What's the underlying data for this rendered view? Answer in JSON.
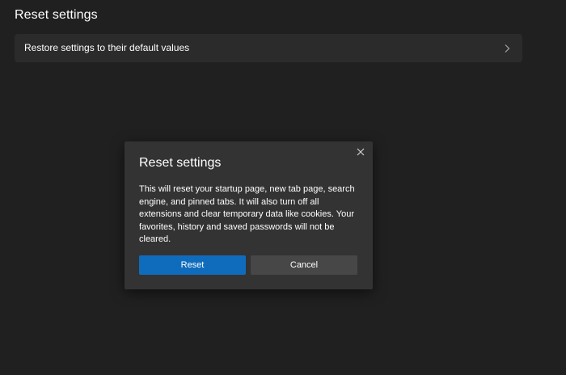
{
  "page": {
    "title": "Reset settings"
  },
  "settings_row": {
    "label": "Restore settings to their default values",
    "icon": "chevron-right-icon"
  },
  "dialog": {
    "title": "Reset settings",
    "body": "This will reset your startup page, new tab page, search engine, and pinned tabs. It will also turn off all extensions and clear temporary data like cookies. Your favorites, history and saved passwords will not be cleared.",
    "close_icon": "close-icon",
    "primary_button_label": "Reset",
    "secondary_button_label": "Cancel"
  },
  "colors": {
    "background": "#202020",
    "card": "#2b2b2b",
    "dialog": "#333333",
    "accent": "#0f6cbd",
    "secondary_button": "#474747"
  }
}
